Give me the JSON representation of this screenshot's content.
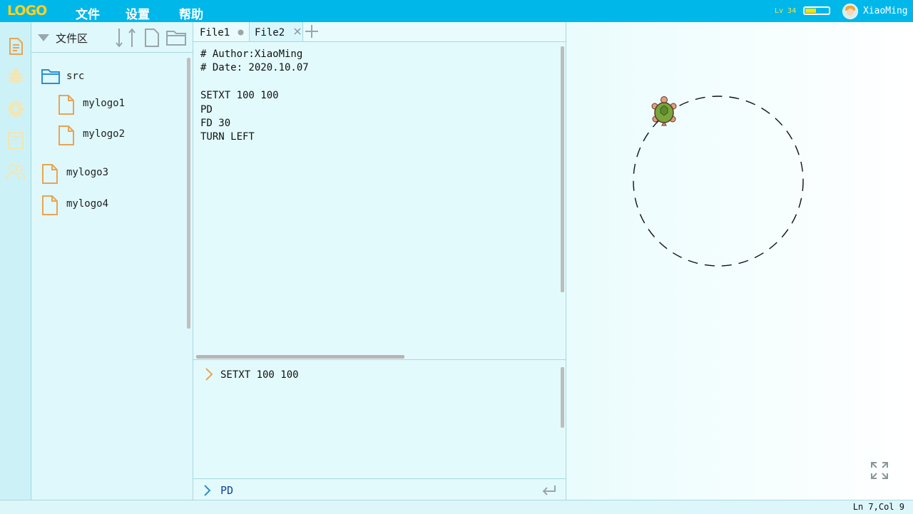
{
  "app": {
    "logo": "LOGO"
  },
  "menu": {
    "file": "文件",
    "settings": "设置",
    "help": "帮助"
  },
  "user": {
    "level": "Lv 34",
    "name": "XiaoMing",
    "progress": 0.45
  },
  "sidebar_icons": [
    "file-icon",
    "bug-icon",
    "gear-icon",
    "book-icon",
    "users-icon"
  ],
  "file_panel": {
    "title": "文件区",
    "tree": {
      "folder": "src",
      "children": [
        "mylogo1",
        "mylogo2"
      ],
      "files": [
        "mylogo3",
        "mylogo4"
      ]
    }
  },
  "editor": {
    "tabs": [
      {
        "label": "File1"
      },
      {
        "label": "File2"
      }
    ],
    "code": "# Author:XiaoMing\n# Date: 2020.10.07\n\nSETXT 100 100\nPD\nFD 30\nTURN LEFT"
  },
  "console": {
    "last": "SETXT 100 100"
  },
  "command": {
    "value": "PD"
  },
  "status": {
    "position": "Ln 7,Col 9"
  },
  "colors": {
    "topbar": "#00b7ea",
    "logo": "#ffd21f",
    "accent": "#e8a455"
  }
}
